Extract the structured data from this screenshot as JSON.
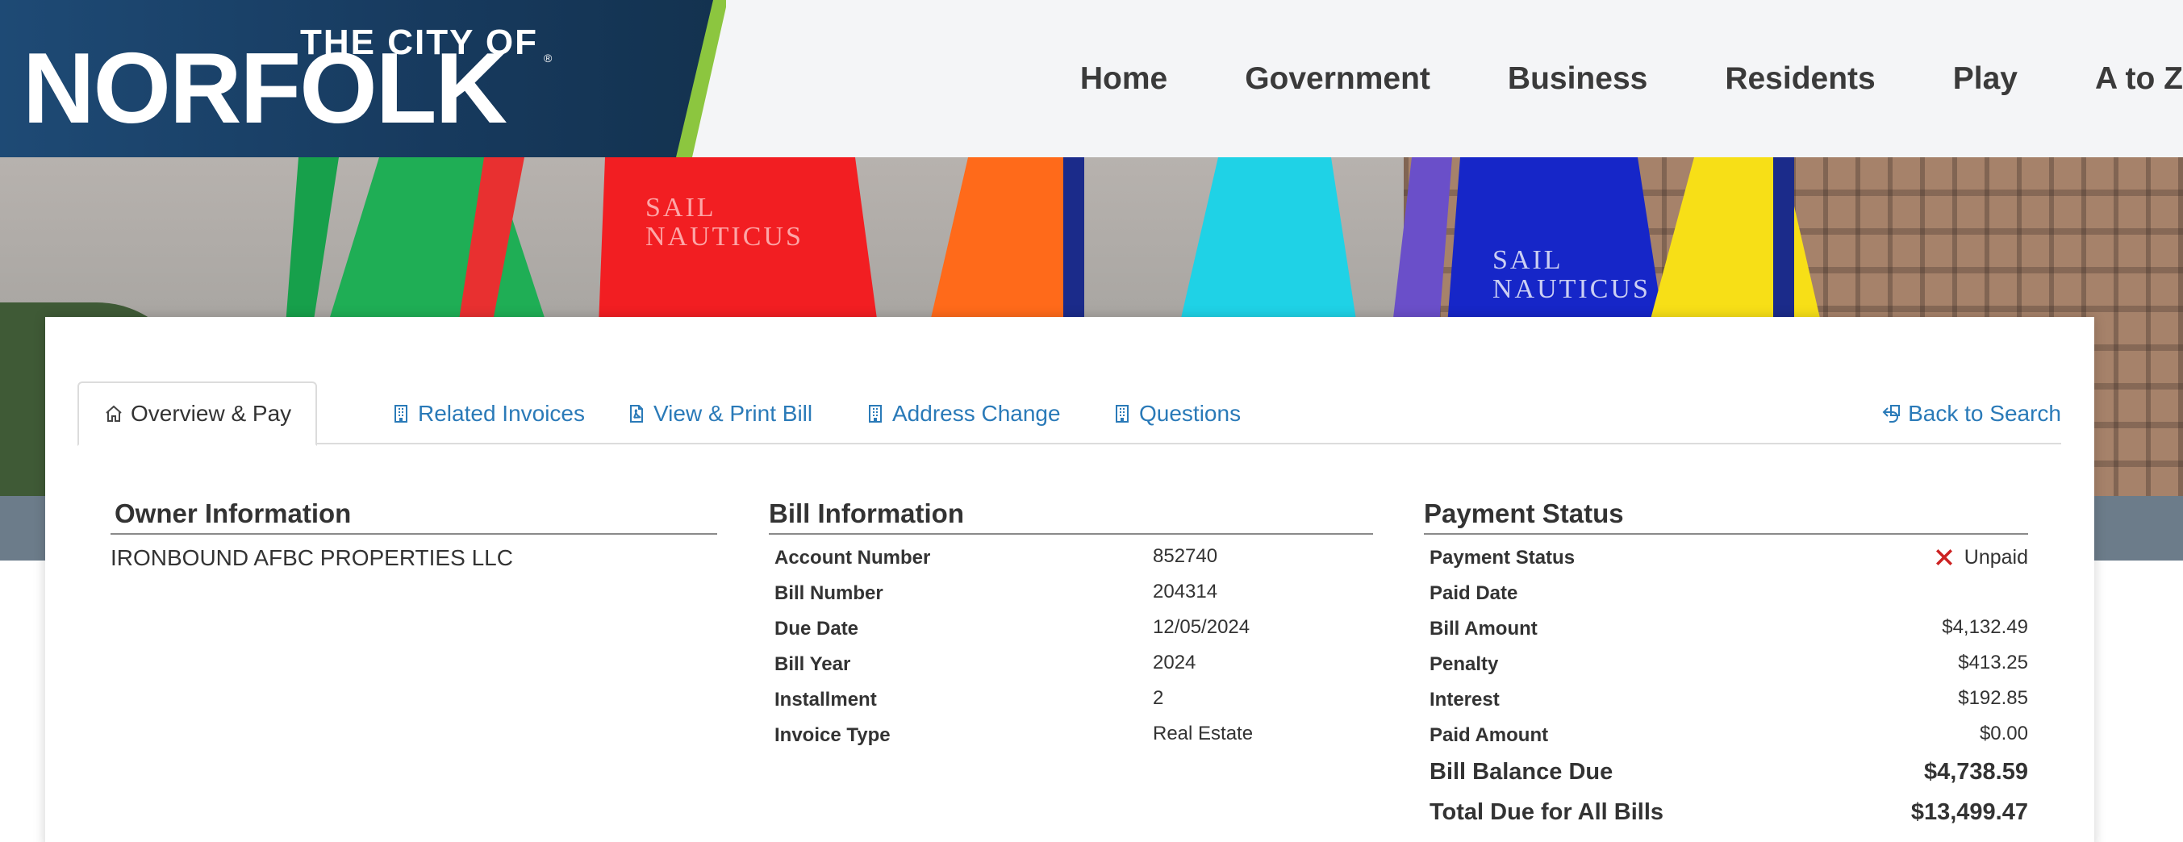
{
  "logo": {
    "line1": "THE CITY OF",
    "line2": "NORFOLK",
    "reg": "®"
  },
  "nav": [
    "Home",
    "Government",
    "Business",
    "Residents",
    "Play",
    "A to Z"
  ],
  "hero": {
    "sail_text_1": "SAIL\nNAUTICUS",
    "sail_text_2": "SAIL\nNAUTICUS"
  },
  "tabs": [
    {
      "label": "Overview & Pay",
      "icon": "home-icon",
      "active": true
    },
    {
      "label": "Related Invoices",
      "icon": "building-icon",
      "active": false
    },
    {
      "label": "View & Print Bill",
      "icon": "pdf-file-icon",
      "active": false
    },
    {
      "label": "Address Change",
      "icon": "building-icon",
      "active": false
    },
    {
      "label": "Questions",
      "icon": "building-icon",
      "active": false
    }
  ],
  "back_to_search": {
    "label": "Back to Search",
    "icon": "back-arrow-icon"
  },
  "owner": {
    "title": "Owner Information",
    "name": "IRONBOUND AFBC PROPERTIES LLC"
  },
  "bill": {
    "title": "Bill Information",
    "rows": [
      {
        "label": "Account Number",
        "value": "852740"
      },
      {
        "label": "Bill Number",
        "value": "204314"
      },
      {
        "label": "Due Date",
        "value": "12/05/2024"
      },
      {
        "label": "Bill Year",
        "value": "2024"
      },
      {
        "label": "Installment",
        "value": "2"
      },
      {
        "label": "Invoice Type",
        "value": "Real Estate"
      }
    ]
  },
  "payment": {
    "title": "Payment Status",
    "status_label": "Payment Status",
    "status_value": "Unpaid",
    "status_icon": "x-icon",
    "status_color": "#cc2222",
    "rows": [
      {
        "label": "Paid Date",
        "value": ""
      },
      {
        "label": "Bill Amount",
        "value": "$4,132.49"
      },
      {
        "label": "Penalty",
        "value": "$413.25"
      },
      {
        "label": "Interest",
        "value": "$192.85"
      },
      {
        "label": "Paid Amount",
        "value": "$0.00"
      }
    ],
    "balance_label": "Bill Balance Due",
    "balance_value": "$4,738.59",
    "total_label": "Total Due for All Bills",
    "total_value": "$13,499.47"
  },
  "colors": {
    "navy": "#173a5e",
    "green": "#8cc63f",
    "link": "#2a7ab8"
  }
}
